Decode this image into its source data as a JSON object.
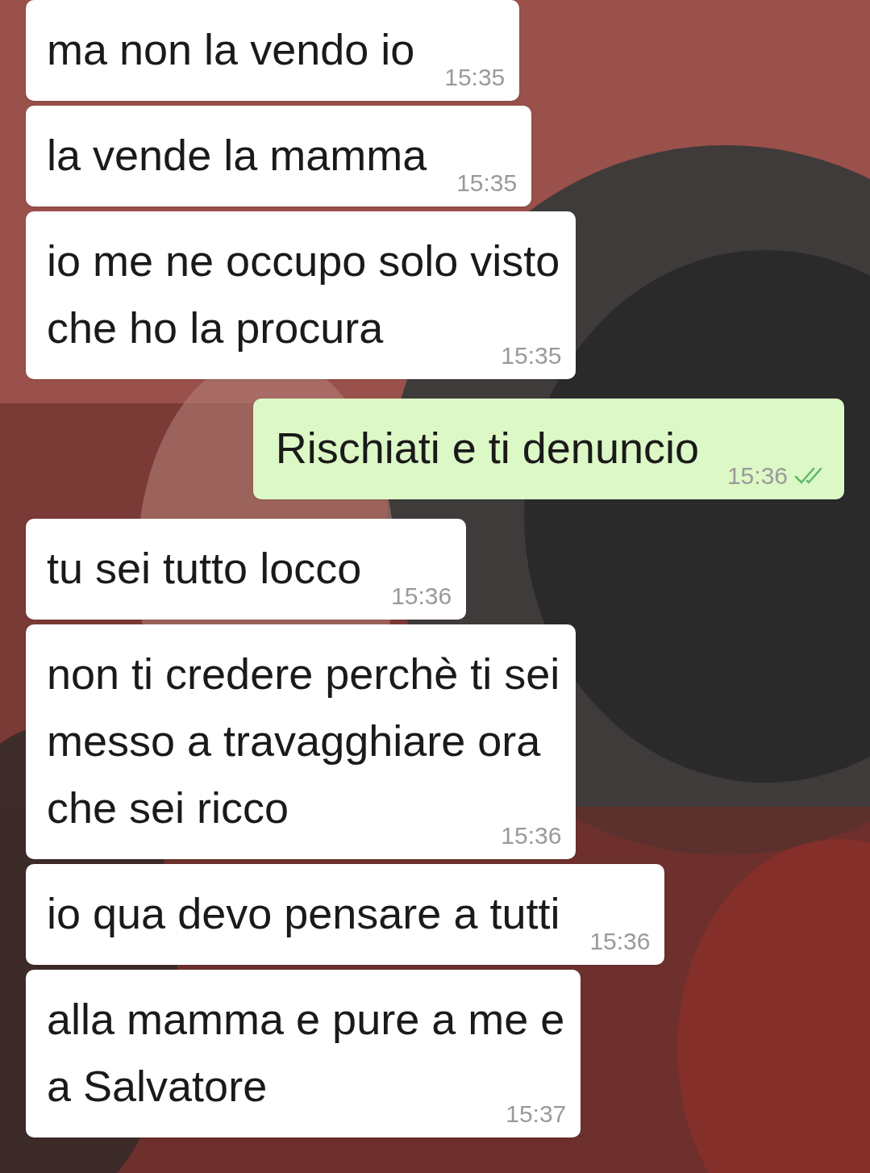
{
  "messages": [
    {
      "outgoing": false,
      "text": "ma non la vendo io",
      "time": "15:35"
    },
    {
      "outgoing": false,
      "text": "la vende la mamma",
      "time": "15:35"
    },
    {
      "outgoing": false,
      "text": "io me ne occupo solo visto\nche ho la procura",
      "time": "15:35"
    },
    {
      "outgoing": true,
      "text": "Rischiati e ti denuncio",
      "time": "15:36",
      "read": true
    },
    {
      "outgoing": false,
      "text": "tu sei tutto locco",
      "time": "15:36"
    },
    {
      "outgoing": false,
      "text": "non ti credere perchè ti sei\nmesso a travagghiare ora\nche sei ricco",
      "time": "15:36"
    },
    {
      "outgoing": false,
      "text": "io qua devo pensare a tutti",
      "time": "15:36"
    },
    {
      "outgoing": false,
      "text": "alla mamma e pure a me e\na Salvatore",
      "time": "15:37"
    }
  ]
}
